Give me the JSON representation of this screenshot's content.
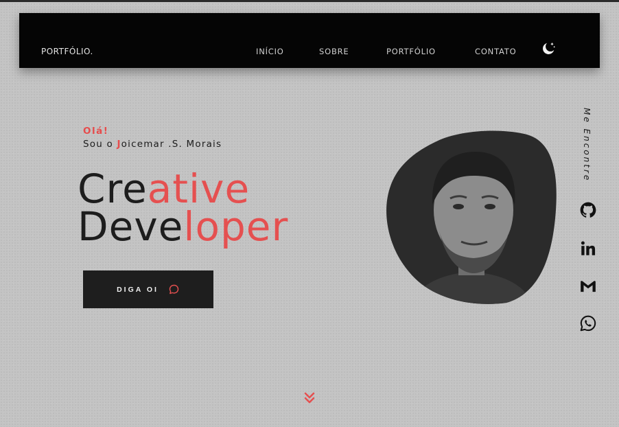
{
  "navbar": {
    "brand": "PORTFÓLIO.",
    "links": [
      "INÍCIO",
      "SOBRE",
      "PORTFÓLIO",
      "CONTATO"
    ],
    "theme_icon": "moon-stars-icon"
  },
  "hero": {
    "greeting": "Olá!",
    "intro_prefix": "Sou o ",
    "intro_initial": "J",
    "intro_rest": "oicemar .S. Morais",
    "headline_line1": {
      "dark": "Cre",
      "red": "ative"
    },
    "headline_line2": {
      "dark": "Deve",
      "red": "loper"
    },
    "cta_label": "DIGA  OI",
    "cta_icon": "chat-bubble-icon",
    "portrait_icon": "portrait-photo"
  },
  "social": {
    "heading": "Me Encontre",
    "icons": [
      "github-icon",
      "linkedin-icon",
      "gmail-icon",
      "whatsapp-icon"
    ]
  },
  "scroll_icon": "double-chevron-down-icon",
  "colors": {
    "accent": "#e55050",
    "background": "#c4c4c4",
    "navbar": "#050505",
    "text_dark": "#1d1d1d",
    "button": "#1e1e1e"
  }
}
